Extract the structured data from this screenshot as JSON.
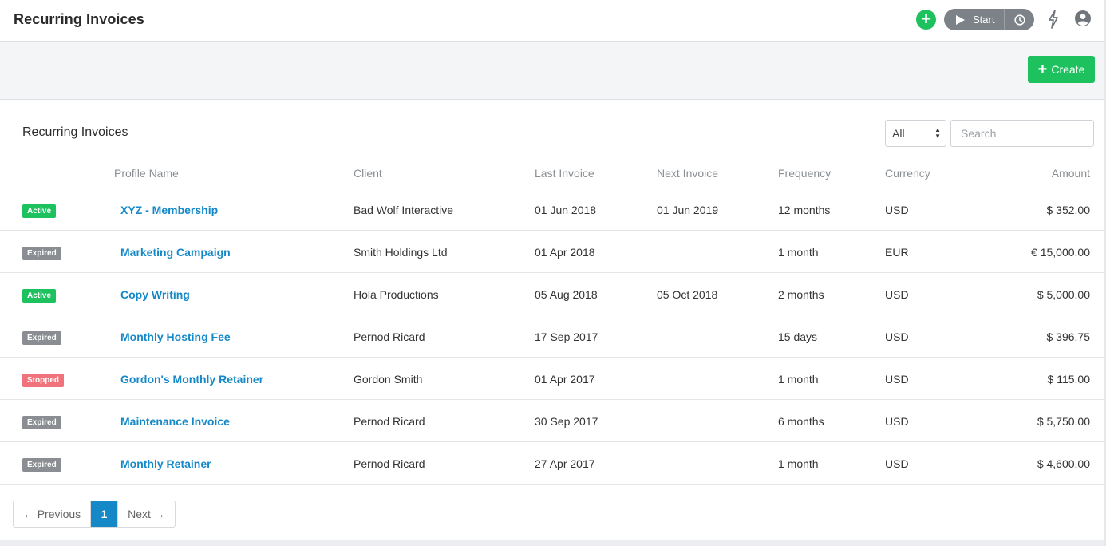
{
  "header": {
    "title": "Recurring Invoices",
    "timer_label": "Start"
  },
  "toolbar": {
    "create_label": "Create"
  },
  "card": {
    "title": "Recurring Invoices",
    "filter_value": "All",
    "search_placeholder": "Search"
  },
  "columns": {
    "profile": "Profile Name",
    "client": "Client",
    "last": "Last Invoice",
    "next": "Next Invoice",
    "frequency": "Frequency",
    "currency": "Currency",
    "amount": "Amount"
  },
  "rows": [
    {
      "status": "Active",
      "profile": "XYZ - Membership",
      "client": "Bad Wolf Interactive",
      "last": "01 Jun 2018",
      "next": "01 Jun 2019",
      "frequency": "12 months",
      "currency": "USD",
      "amount": "$ 352.00"
    },
    {
      "status": "Expired",
      "profile": "Marketing Campaign",
      "client": "Smith Holdings Ltd",
      "last": "01 Apr 2018",
      "next": "",
      "frequency": "1 month",
      "currency": "EUR",
      "amount": "€ 15,000.00"
    },
    {
      "status": "Active",
      "profile": "Copy Writing",
      "client": "Hola Productions",
      "last": "05 Aug 2018",
      "next": "05 Oct 2018",
      "frequency": "2 months",
      "currency": "USD",
      "amount": "$ 5,000.00"
    },
    {
      "status": "Expired",
      "profile": "Monthly Hosting Fee",
      "client": "Pernod Ricard",
      "last": "17 Sep 2017",
      "next": "",
      "frequency": "15 days",
      "currency": "USD",
      "amount": "$ 396.75"
    },
    {
      "status": "Stopped",
      "profile": "Gordon's Monthly Retainer",
      "client": "Gordon Smith",
      "last": "01 Apr 2017",
      "next": "",
      "frequency": "1 month",
      "currency": "USD",
      "amount": "$ 115.00"
    },
    {
      "status": "Expired",
      "profile": "Maintenance Invoice",
      "client": "Pernod Ricard",
      "last": "30 Sep 2017",
      "next": "",
      "frequency": "6 months",
      "currency": "USD",
      "amount": "$ 5,750.00"
    },
    {
      "status": "Expired",
      "profile": "Monthly Retainer",
      "client": "Pernod Ricard",
      "last": "27 Apr 2017",
      "next": "",
      "frequency": "1 month",
      "currency": "USD",
      "amount": "$ 4,600.00"
    }
  ],
  "status_colors": {
    "Active": "#1dc25f",
    "Expired": "#8a8d91",
    "Stopped": "#f0727a"
  },
  "pagination": {
    "prev_label": "← Previous",
    "current_page": "1",
    "next_label": "Next →"
  },
  "icons": {
    "add": "plus-circle-icon",
    "timer": "play-icon",
    "clock": "clock-icon",
    "bolt": "lightning-icon",
    "user": "user-circle-icon"
  }
}
